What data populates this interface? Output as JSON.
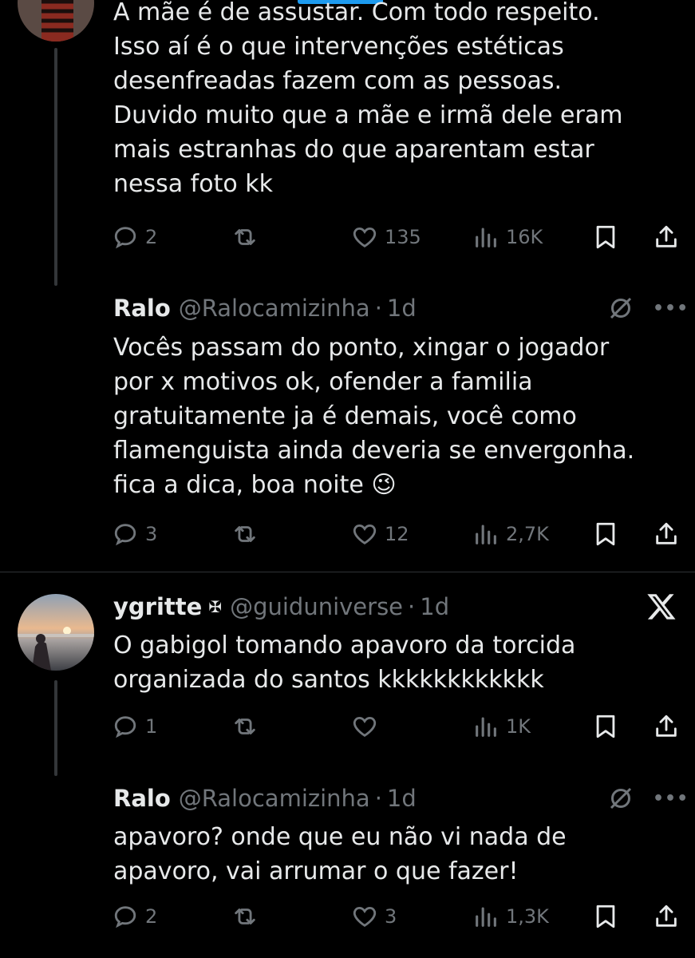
{
  "tweets": [
    {
      "text": "A mãe é de assustar. Com todo respeito.\nIsso aí é o que intervenções estéticas\ndesenfreadas fazem com as pessoas.\nDuvido muito que a mãe e irmã dele eram\nmais estranhas do que aparentam estar\nnessa foto kk",
      "replies": "2",
      "retweets": "",
      "likes": "135",
      "views": "16K"
    },
    {
      "name": "Ralo",
      "handle": "@Ralocamizinha",
      "dot": "·",
      "time": "1d",
      "text": "Vocês passam do ponto, xingar o jogador\npor x motivos ok, ofender a familia\ngratuitamente ja é demais, você como\nflamenguista ainda deveria se envergonha.\nfica a dica, boa noite 😉",
      "replies": "3",
      "retweets": "",
      "likes": "12",
      "views": "2,7K"
    },
    {
      "name": "ygritte",
      "badge": "✠",
      "handle": "@guiduniverse",
      "dot": "·",
      "time": "1d",
      "text": "O gabigol tomando apavoro da torcida\norganizada do santos kkkkkkkkkkkk",
      "replies": "1",
      "retweets": "",
      "likes": "",
      "views": "1K"
    },
    {
      "name": "Ralo",
      "handle": "@Ralocamizinha",
      "dot": "·",
      "time": "1d",
      "text": "apavoro? onde que eu não vi nada de\napavoro, vai arrumar o que fazer!",
      "replies": "2",
      "retweets": "",
      "likes": "3",
      "views": "1,3K"
    }
  ],
  "icons": {
    "reply": "reply-icon",
    "retweet": "retweet-icon",
    "like": "heart-icon",
    "views": "views-icon",
    "bookmark": "bookmark-icon",
    "share": "share-icon",
    "no-notifications": "slashed-circle-icon",
    "more": "more-icon",
    "x-logo": "x-logo-icon"
  },
  "more_label": "•••",
  "colors": {
    "background": "#000000",
    "text": "#e7e9ea",
    "secondary": "#71767b",
    "accent": "#1d9bf0",
    "divider": "#2f3336"
  }
}
